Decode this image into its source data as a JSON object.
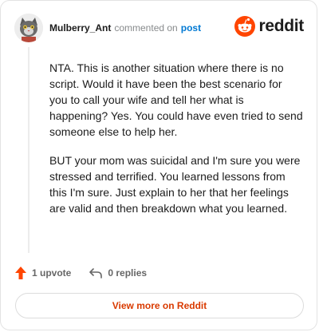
{
  "header": {
    "username": "Mulberry_Ant",
    "action_text": "commented on",
    "post_link": "post",
    "brand": "reddit"
  },
  "comment": {
    "paragraphs": [
      "NTA. This is another situation where there is no script. Would it have been the best scenario for you to call your wife and tell her what is happening? Yes. You could have even tried to send someone else to help her.",
      "BUT your mom was suicidal and I'm sure you were stressed and terrified. You learned lessons from this I'm sure. Just explain to her that her feelings are valid and then breakdown what you learned."
    ]
  },
  "actions": {
    "upvote_label": "1 upvote",
    "replies_label": "0 replies"
  },
  "footer": {
    "view_more_label": "View more on Reddit"
  },
  "colors": {
    "brand": "#ff4500",
    "link": "#0079d3",
    "cta": "#d93a00",
    "upvote": "#ff4500"
  },
  "icons": {
    "avatar": "cat-avatar-icon",
    "brand": "reddit-snoo-icon",
    "upvote": "upvote-arrow-icon",
    "reply": "reply-arrow-icon"
  }
}
